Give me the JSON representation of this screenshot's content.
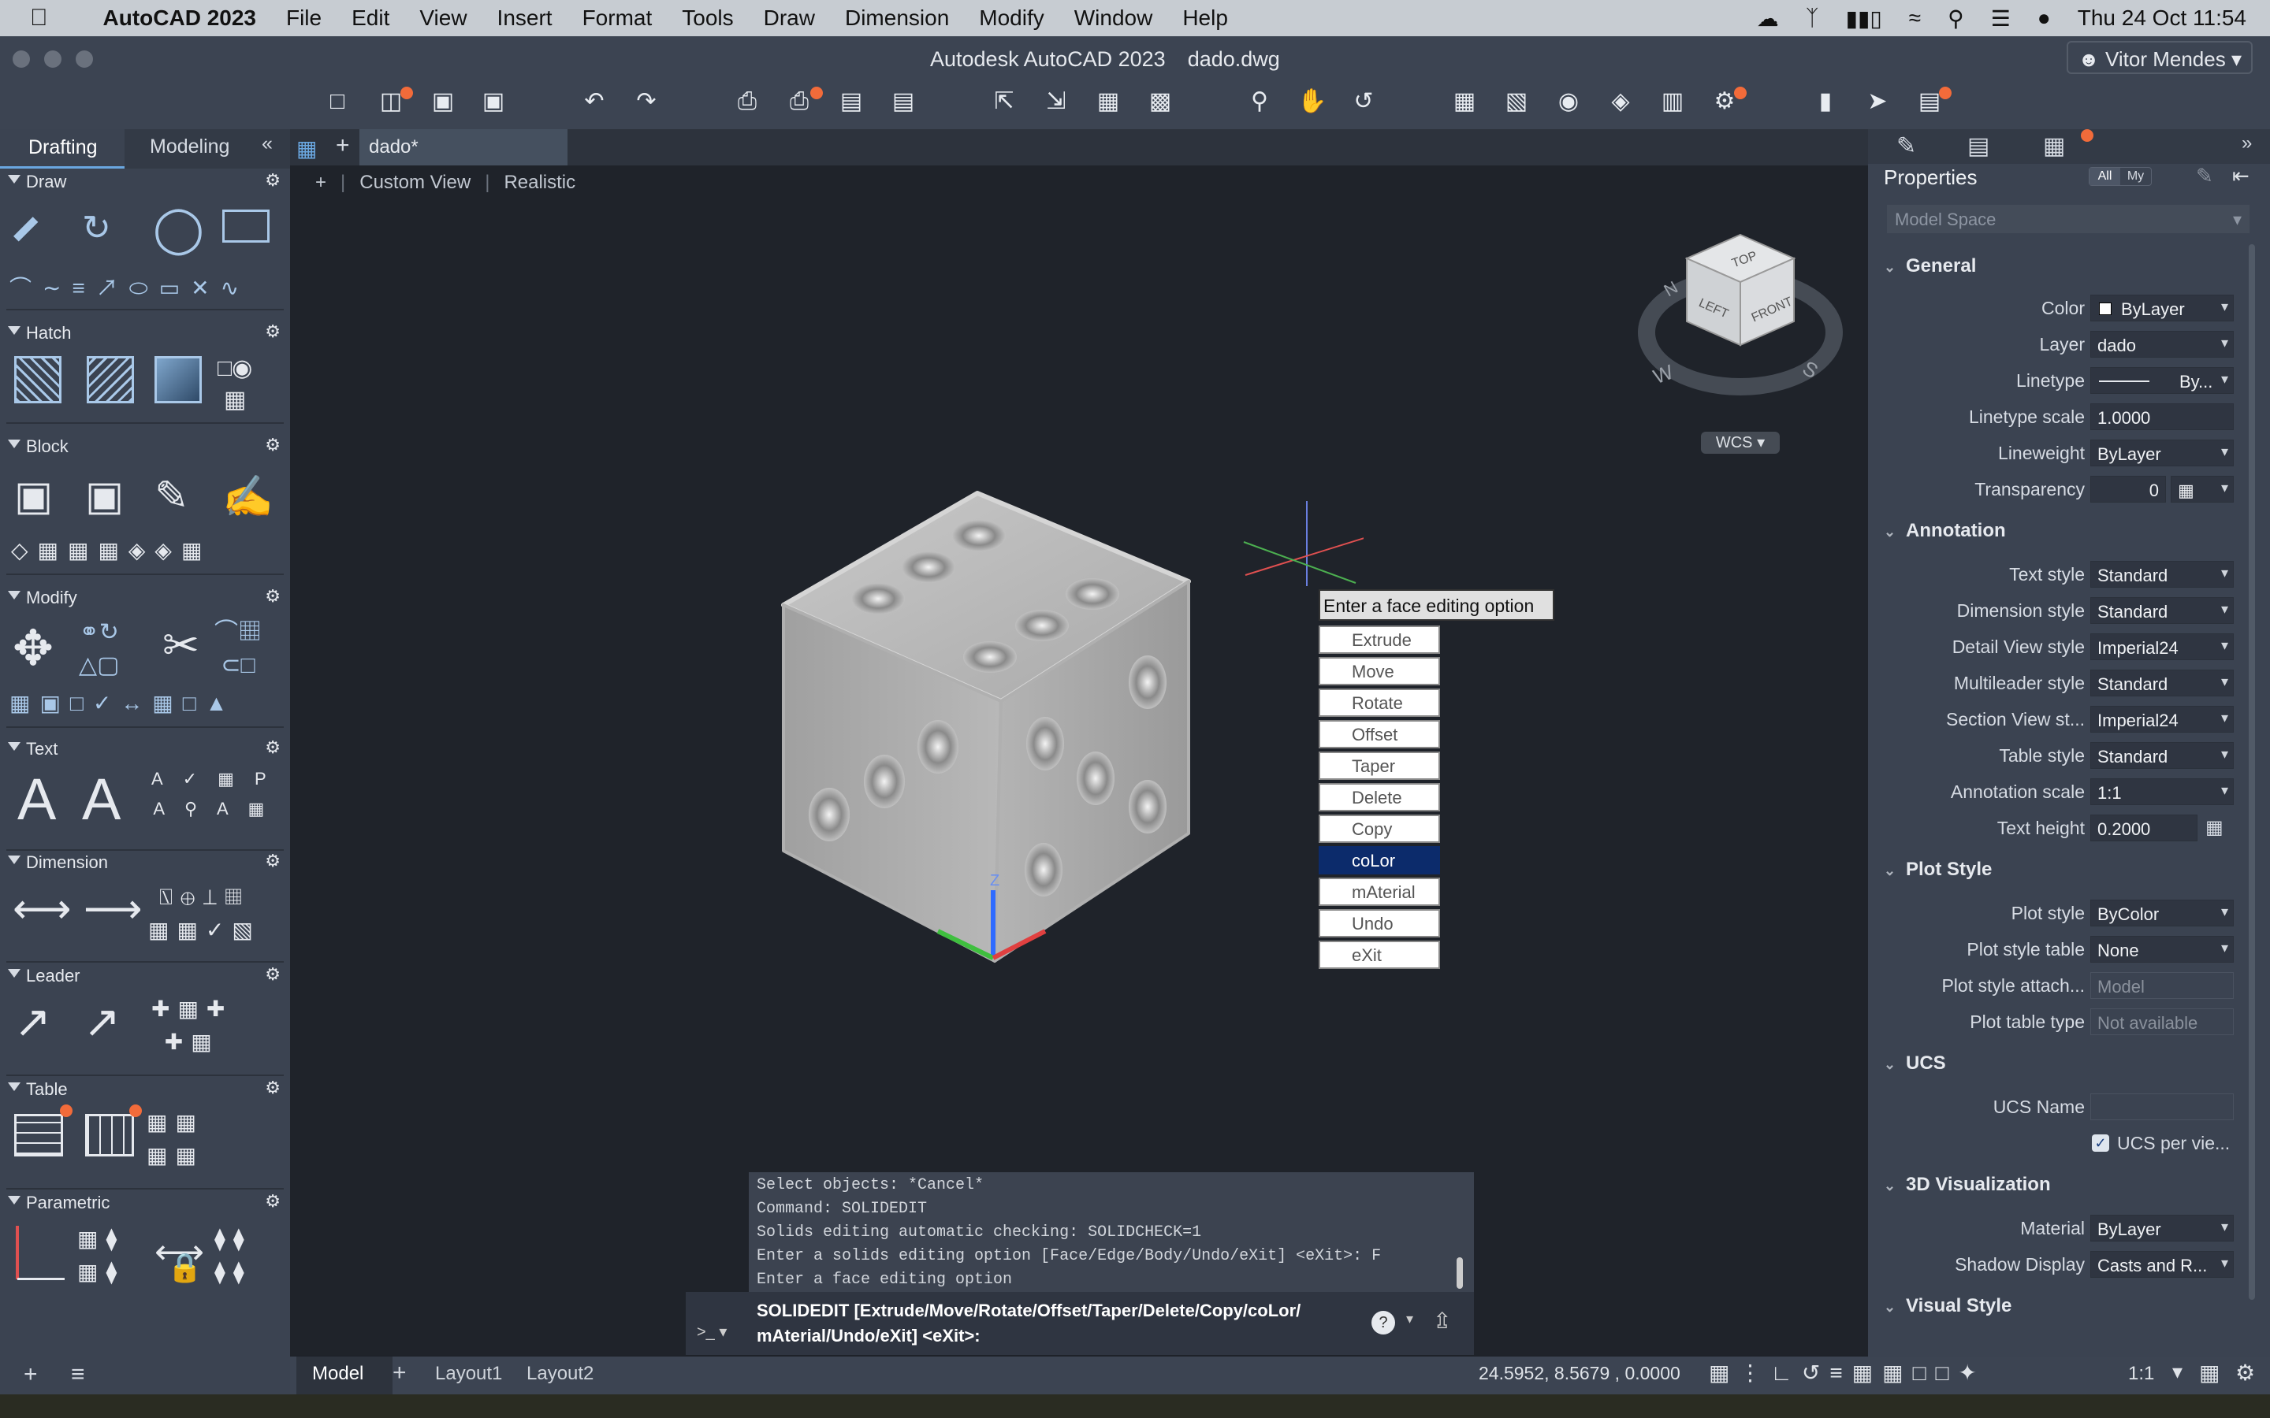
{
  "menubar": {
    "app": "AutoCAD 2023",
    "items": [
      "File",
      "Edit",
      "View",
      "Insert",
      "Format",
      "Tools",
      "Draw",
      "Dimension",
      "Modify",
      "Window",
      "Help"
    ],
    "datetime": "Thu 24 Oct  11:54"
  },
  "window": {
    "title": "Autodesk AutoCAD 2023",
    "file": "dado.dwg",
    "user": "Vitor Mendes"
  },
  "left_panel": {
    "tabs": [
      "Drafting",
      "Modeling"
    ],
    "sections": [
      "Draw",
      "Hatch",
      "Block",
      "Modify",
      "Text",
      "Dimension",
      "Leader",
      "Table",
      "Parametric"
    ]
  },
  "doc_tab": "dado*",
  "viewport": {
    "view": "Custom View",
    "style": "Realistic",
    "wcs": "WCS",
    "cube_faces": [
      "TOP",
      "LEFT",
      "FRONT"
    ],
    "compass": [
      "N",
      "W",
      "S"
    ]
  },
  "face_menu": {
    "prompt": "Enter a face editing option",
    "options": [
      "Extrude",
      "Move",
      "Rotate",
      "Offset",
      "Taper",
      "Delete",
      "Copy",
      "coLor",
      "mAterial",
      "Undo",
      "eXit"
    ],
    "selected": "coLor"
  },
  "command": {
    "history": [
      "Select objects: *Cancel*",
      "Command: SOLIDEDIT",
      "Solids editing automatic checking:  SOLIDCHECK=1",
      "Enter a solids editing option [Face/Edge/Body/Undo/eXit] <eXit>: F",
      "Enter a face editing option"
    ],
    "current_line1": "SOLIDEDIT [Extrude/Move/Rotate/Offset/Taper/Delete/Copy/coLor/",
    "current_line2": "mAterial/Undo/eXit] <eXit>:",
    "prompt_symbol": ">_"
  },
  "status": {
    "tabs": [
      "Model",
      "Layout1",
      "Layout2"
    ],
    "coords": "24.5952, 8.5679 , 0.0000",
    "scale": "1:1"
  },
  "properties": {
    "title": "Properties",
    "filter": [
      "All",
      "My"
    ],
    "space": "Model Space",
    "sections": [
      {
        "name": "General",
        "rows": [
          [
            "Color",
            "ByLayer"
          ],
          [
            "Layer",
            "dado"
          ],
          [
            "Linetype",
            "By..."
          ],
          [
            "Linetype scale",
            "1.0000"
          ],
          [
            "Lineweight",
            "ByLayer"
          ],
          [
            "Transparency",
            "0"
          ]
        ]
      },
      {
        "name": "Annotation",
        "rows": [
          [
            "Text style",
            "Standard"
          ],
          [
            "Dimension style",
            "Standard"
          ],
          [
            "Detail View style",
            "Imperial24"
          ],
          [
            "Multileader style",
            "Standard"
          ],
          [
            "Section View st...",
            "Imperial24"
          ],
          [
            "Table style",
            "Standard"
          ],
          [
            "Annotation scale",
            "1:1"
          ],
          [
            "Text height",
            "0.2000"
          ]
        ]
      },
      {
        "name": "Plot Style",
        "rows": [
          [
            "Plot style",
            "ByColor"
          ],
          [
            "Plot style table",
            "None"
          ],
          [
            "Plot style attach...",
            "Model"
          ],
          [
            "Plot table type",
            "Not available"
          ]
        ]
      },
      {
        "name": "UCS",
        "rows": [
          [
            "UCS Name",
            ""
          ],
          [
            "",
            "UCS per vie..."
          ]
        ]
      },
      {
        "name": "3D Visualization",
        "rows": [
          [
            "Material",
            "ByLayer"
          ],
          [
            "Shadow Display",
            "Casts and R..."
          ]
        ]
      },
      {
        "name": "Visual Style",
        "rows": []
      }
    ]
  }
}
